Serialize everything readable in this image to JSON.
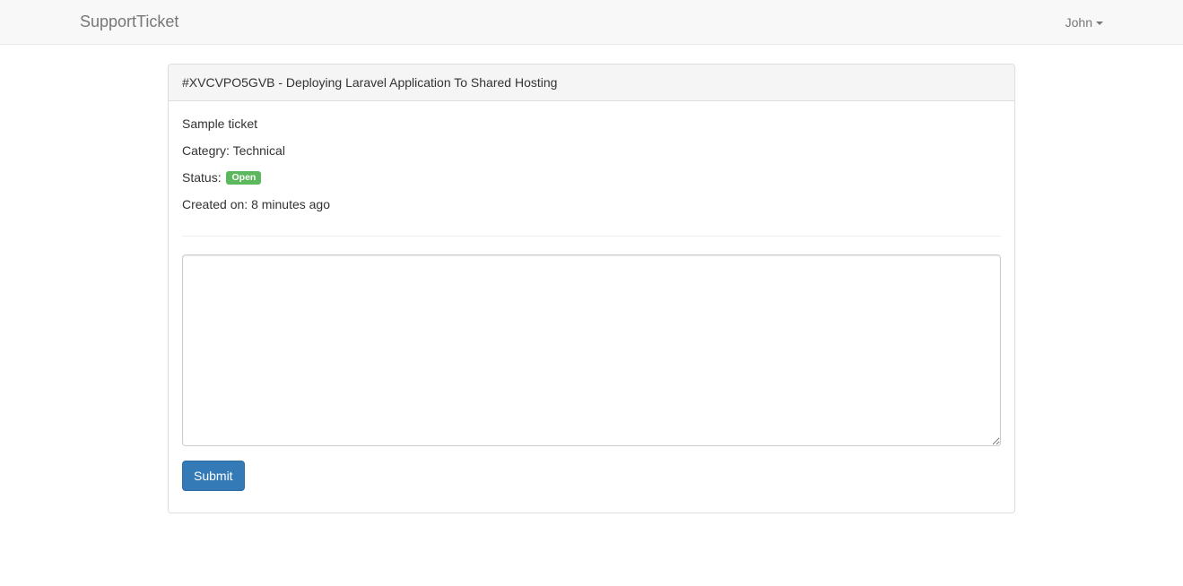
{
  "navbar": {
    "brand": "SupportTicket",
    "user": "John",
    "user_caret_icon": "caret-down-icon"
  },
  "ticket": {
    "heading": "#XVCVPO5GVB - Deploying Laravel Application To Shared Hosting",
    "message": "Sample ticket",
    "category_label": "Categry:",
    "category_value": "Technical",
    "status_label": "Status:",
    "status_value": "Open",
    "status_color": "#5cb85c",
    "created_label": "Created on:",
    "created_value": "8 minutes ago"
  },
  "reply_form": {
    "comment_value": "",
    "submit_label": "Submit",
    "submit_color": "#337ab7"
  }
}
